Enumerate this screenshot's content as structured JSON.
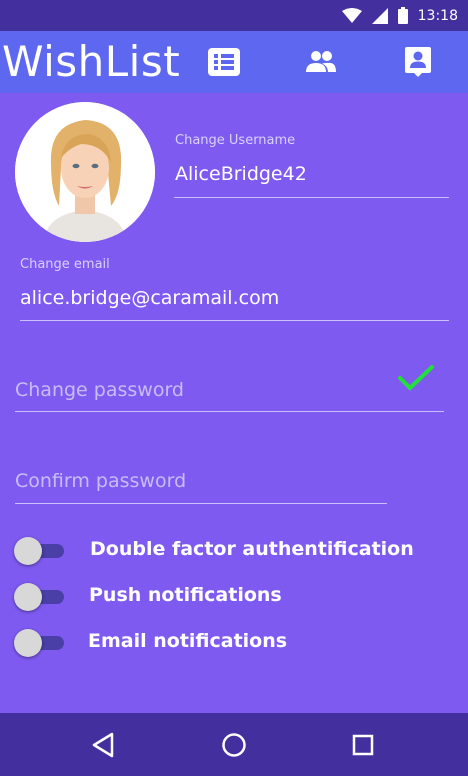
{
  "status_bar": {
    "time": "13:18",
    "icons": [
      "wifi-icon",
      "signal-icon",
      "battery-icon"
    ]
  },
  "app_bar": {
    "title": "WishList",
    "actions": [
      {
        "icon": "list-icon"
      },
      {
        "icon": "people-icon"
      },
      {
        "icon": "contact-icon"
      }
    ]
  },
  "profile": {
    "username_label": "Change Username",
    "username_value": "AliceBridge42",
    "email_label": "Change email",
    "email_value": "alice.bridge@caramail.com",
    "password_placeholder": "Change password",
    "confirm_placeholder": "Confirm password"
  },
  "toggles": [
    {
      "label": "Double factor authentification",
      "on": false
    },
    {
      "label": "Push notifications",
      "on": false
    },
    {
      "label": "Email notifications",
      "on": false
    }
  ],
  "nav": [
    "back-icon",
    "home-icon",
    "recents-icon"
  ],
  "colors": {
    "background": "#7f5af0",
    "app_bar": "#5d67f0",
    "status_bar": "#432f9e",
    "check": "#22e03a"
  }
}
